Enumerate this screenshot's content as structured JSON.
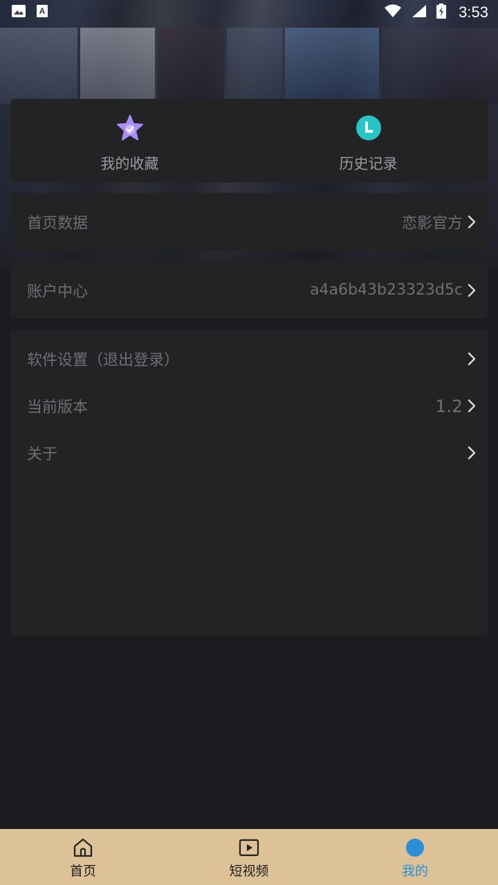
{
  "status_bar": {
    "time": "3:53",
    "icons": [
      "image-icon",
      "font-icon",
      "wifi-icon",
      "signal-icon",
      "battery-charging-icon"
    ]
  },
  "quick_actions": [
    {
      "label": "我的收藏",
      "icon": "star-check-icon",
      "color": "#a98cf5"
    },
    {
      "label": "历史记录",
      "icon": "clock-icon",
      "color": "#26c6c6"
    }
  ],
  "rows": {
    "home_data": {
      "title": "首页数据",
      "value": "恋影官方"
    },
    "account": {
      "title": "账户中心",
      "value": "a4a6b43b23323d5c"
    }
  },
  "settings": [
    {
      "title": "软件设置（退出登录）",
      "value": ""
    },
    {
      "title": "当前版本",
      "value": "1.2"
    },
    {
      "title": "关于",
      "value": ""
    }
  ],
  "nav": {
    "items": [
      {
        "label": "首页",
        "icon": "home-icon"
      },
      {
        "label": "短视频",
        "icon": "play-icon"
      },
      {
        "label": "我的",
        "icon": "profile-icon"
      }
    ],
    "active_index": 2,
    "background": "#dcc296",
    "active_color": "#2a8fd8"
  }
}
